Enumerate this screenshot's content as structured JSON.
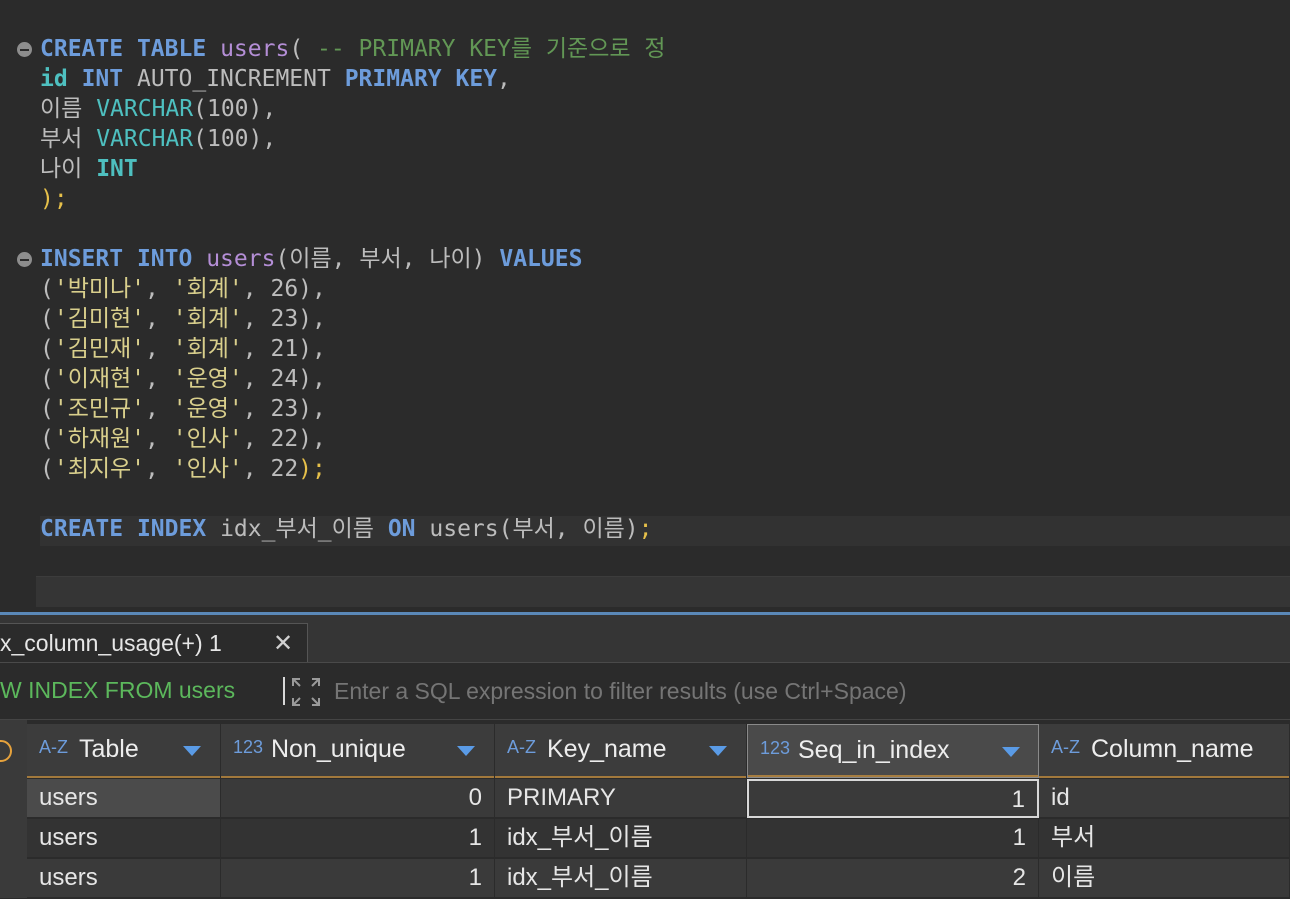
{
  "editor": {
    "create_table": {
      "kw_create": "CREATE",
      "kw_table": "TABLE",
      "table_name": "users",
      "paren_open": "( ",
      "comment": "-- PRIMARY KEY를 기준으로 정"
    },
    "col_id": {
      "name": "id",
      "type": "INT",
      "extra": "AUTO_INCREMENT",
      "pk": "PRIMARY KEY",
      "tail": ","
    },
    "col_name": {
      "name": "이름",
      "type": "VARCHAR",
      "args": "(100),",
      "pre": " "
    },
    "col_dept": {
      "name": "부서",
      "type": "VARCHAR",
      "args": "(100),",
      "pre": " "
    },
    "col_age": {
      "name": "나이",
      "type": "INT",
      "pre": " "
    },
    "close": ");",
    "insert": {
      "kw_insert": "INSERT",
      "kw_into": "INTO",
      "table_name": "users",
      "columns": "(이름, 부서, 나이)",
      "kw_values": "VALUES"
    },
    "values_rows": [
      {
        "name": "'박미나'",
        "dept": "'회계'",
        "age": "26",
        "end": "),"
      },
      {
        "name": "'김미현'",
        "dept": "'회계'",
        "age": "23",
        "end": "),"
      },
      {
        "name": "'김민재'",
        "dept": "'회계'",
        "age": "21",
        "end": "),"
      },
      {
        "name": "'이재현'",
        "dept": "'운영'",
        "age": "24",
        "end": "),"
      },
      {
        "name": "'조민규'",
        "dept": "'운영'",
        "age": "23",
        "end": "),"
      },
      {
        "name": "'하재원'",
        "dept": "'인사'",
        "age": "22",
        "end": "),"
      },
      {
        "name": "'최지우'",
        "dept": "'인사'",
        "age": "22",
        "end": ");"
      }
    ],
    "create_index": {
      "kw_create": "CREATE",
      "kw_index": "INDEX",
      "index_name": "idx_부서_이름",
      "kw_on": "ON",
      "target": "users(부서, 이름)",
      "end": ";"
    }
  },
  "results": {
    "tab_label": "x_column_usage(+) 1",
    "tab_close_glyph": "✕",
    "query_text": "W INDEX FROM users",
    "filter_placeholder": "Enter a SQL expression to filter results (use Ctrl+Space)",
    "columns": [
      {
        "type_icon": "A-Z",
        "label": "Table"
      },
      {
        "type_icon": "123",
        "label": "Non_unique"
      },
      {
        "type_icon": "A-Z",
        "label": "Key_name"
      },
      {
        "type_icon": "123",
        "label": "Seq_in_index"
      },
      {
        "type_icon": "A-Z",
        "label": "Column_name"
      }
    ],
    "rows": [
      {
        "table": "users",
        "non_unique": "0",
        "key_name": "PRIMARY",
        "seq": "1",
        "column_name": "id"
      },
      {
        "table": "users",
        "non_unique": "1",
        "key_name": "idx_부서_이름",
        "seq": "1",
        "column_name": "부서"
      },
      {
        "table": "users",
        "non_unique": "1",
        "key_name": "idx_부서_이름",
        "seq": "2",
        "column_name": "이름"
      }
    ]
  }
}
